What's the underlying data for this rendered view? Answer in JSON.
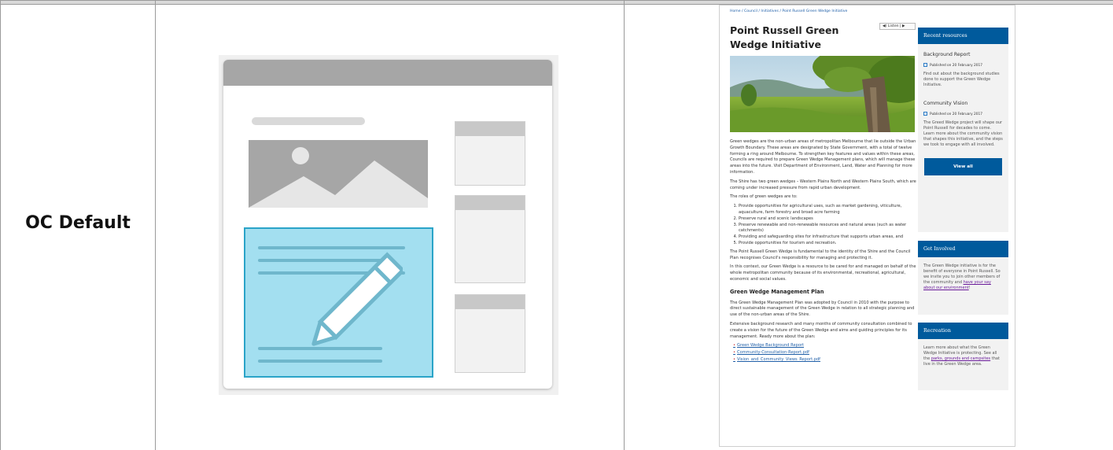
{
  "row_label": "OC Default",
  "page": {
    "breadcrumb": "Home  /  Council  /  Initiatives  /  Point Russell Green Wedge Initiative",
    "listen_label": "◀) Listen  |  ▶",
    "title": "Point Russell Green Wedge Initiative",
    "paragraphs": [
      "Green wedges are the non-urban areas of metropolitan Melbourne that lie outside the Urban Growth Boundary. These areas are designated by State Government, with a total of twelve forming a ring around Melbourne. To strengthen key features and values within these areas, Councils are required to prepare Green Wedge Management plans, which will manage these areas into the future. Visit Department of Environment, Land, Water and Planning for more information.",
      "The Shire has two green wedges – Western Plains North and Western Plains South, which are coming under increased pressure from rapid urban development.",
      "The roles of green wedges are to:"
    ],
    "roles": [
      "Provide opportunities for agricultural uses, such as market gardening, viticulture, aquaculture, farm forestry and broad acre farming",
      "Preserve rural and scenic landscapes",
      "Preserve renewable and non-renewable resources and natural areas (such as water catchments)",
      "Providing and safeguarding sites for infrastructure that supports urban areas, and",
      "Provide opportunities for tourism and recreation."
    ],
    "paragraphs2": [
      "The Point Russell Green Wedge is fundamental to the identity of the Shire and the Council Plan recognises Council's responsibility for managing and protecting it.",
      "In this context, our Green Wedge is a resource to be cared for and managed on behalf of the whole metropolitan community because of its environmental, recreational, agricultural, economic and social values."
    ],
    "section_heading": "Green Wedge Management Plan",
    "paragraphs3": [
      "The Green Wedge Management Plan was adopted by Council in 2010 with the purpose to direct sustainable management of the Green Wedge in relation to all strategic planning and use of the non-urban areas of the Shire.",
      "Extensive background research and many months of community consultation combined to create a vision for the future of the Green Wedge and aims and guiding principles for its management. Ready more about the plan:"
    ],
    "documents": [
      "Green Wedge Background Report",
      "Community-Consultation-Report.pdf",
      "Vision_and_Community_Views_Report.pdf"
    ],
    "sidebar": {
      "recent_heading": "Recent resources",
      "resources": [
        {
          "title": "Background Report",
          "date": "Published on 20 February 2017",
          "desc": "Find out about the background studies done to support the Green Wedge Initiative."
        },
        {
          "title": "Community Vision",
          "date": "Published on 20 February 2017",
          "desc": "The Greed Wedge project will shape our Point Russell for decades to come. Learn more about the community vision that shapes this initiative, and the steps we took to engage with all involved."
        }
      ],
      "view_all": "View all",
      "involved_heading": "Get Involved",
      "involved_text": "The Green Wedge initiative is for the benefit of everyone in Point Russell. So we invite you to join other members of the community and",
      "involved_link": "have your say about our environment",
      "involved_end": "!",
      "recreation_heading": "Recreation",
      "recreation_text": "Learn more about what the Green Wedge Initiative is protecting. See all the",
      "recreation_link": "parks, grounds and campsites",
      "recreation_end": "that live in the Green Wedge area."
    }
  }
}
